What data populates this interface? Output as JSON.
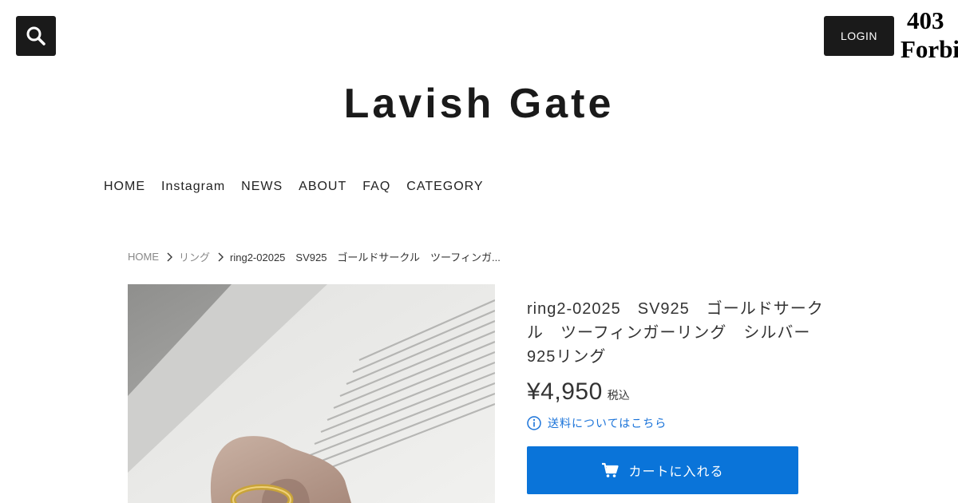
{
  "header": {
    "search_icon": "search-icon",
    "login_label": "LOGIN",
    "error_code": "403",
    "error_text": "Forbidden"
  },
  "brand": {
    "logo_text": "Lavish Gate"
  },
  "nav": {
    "items": [
      "HOME",
      "Instagram",
      "NEWS",
      "ABOUT",
      "FAQ",
      "CATEGORY"
    ]
  },
  "breadcrumb": {
    "items": [
      "HOME",
      "リング",
      "ring2-02025　SV925　ゴールドサークル　ツーフィンガ..."
    ],
    "separator_icon": "chevron-right-icon"
  },
  "product": {
    "title": "ring2-02025　SV925　ゴールドサークル　ツーフィンガーリング　シルバー925リング",
    "price": "¥4,950",
    "tax_label": "税込",
    "shipping_link": "送料についてはこちら",
    "shipping_icon": "info-icon",
    "cart_label": "カートに入れる",
    "cart_icon": "cart-icon"
  },
  "colors": {
    "header_button_bg": "#1a1a1a",
    "link_blue": "#1a73d9",
    "cart_button_bg": "#0a74d9"
  }
}
